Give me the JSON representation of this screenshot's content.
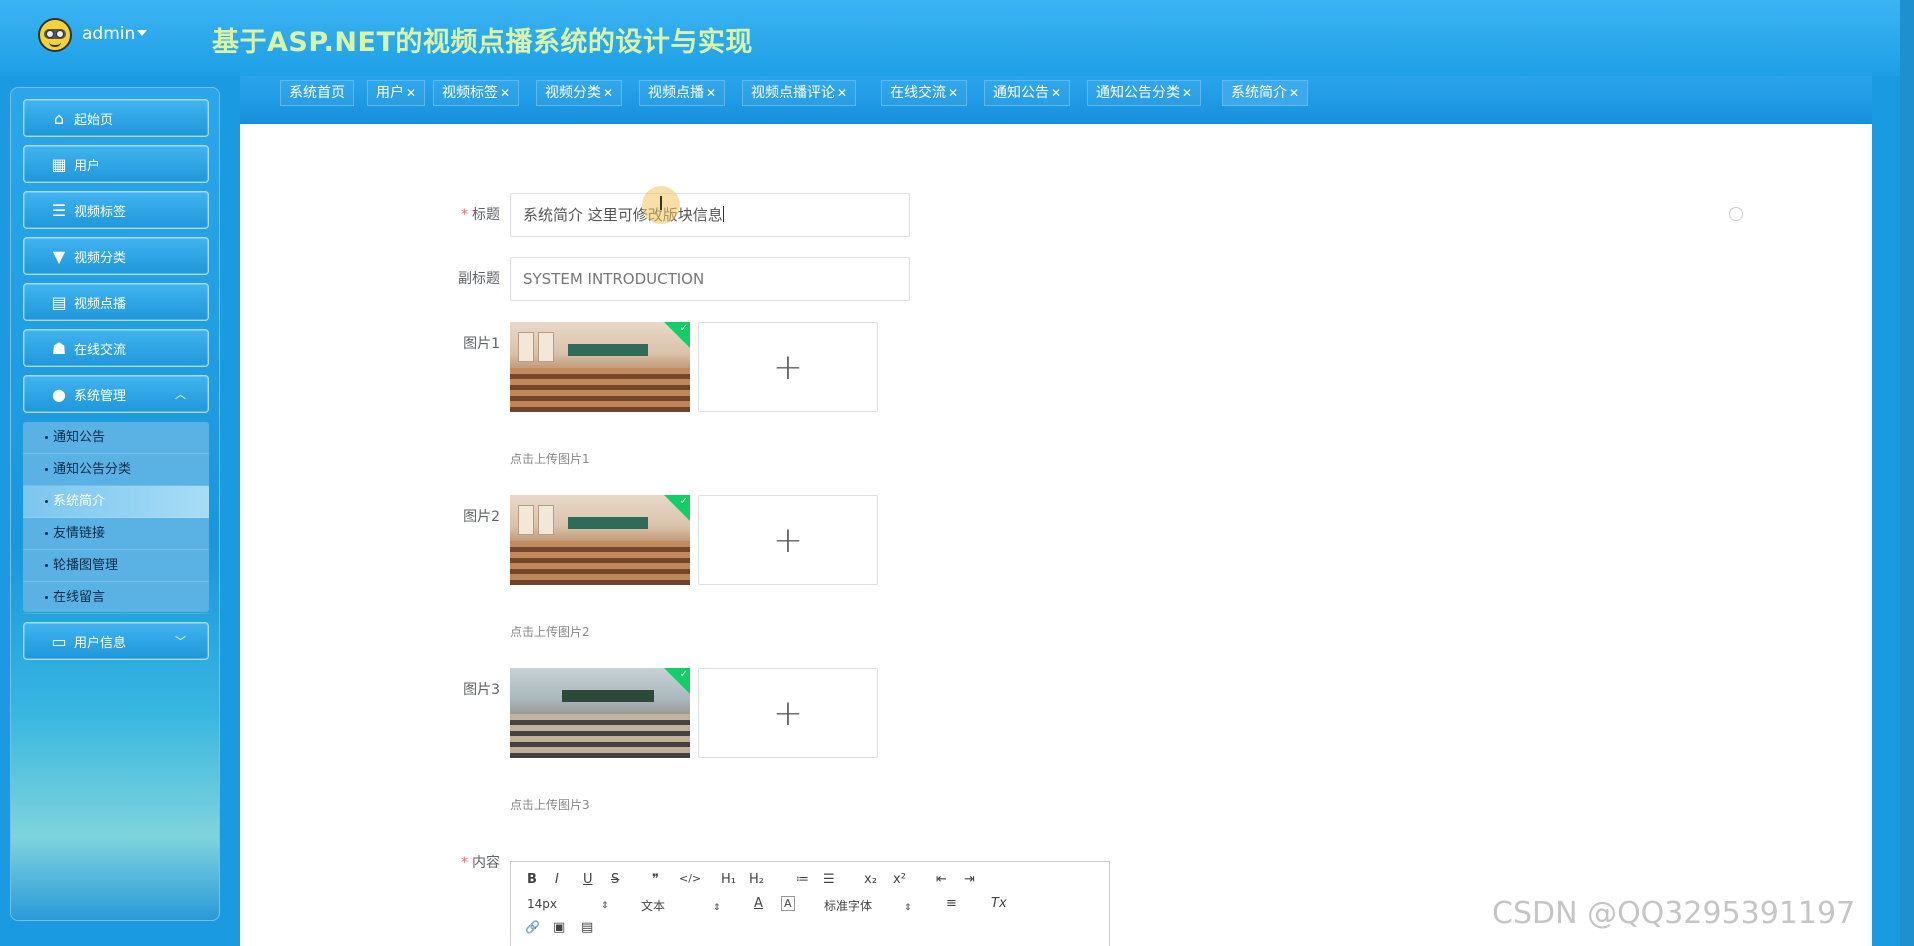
{
  "header": {
    "user": "admin",
    "title": "基于ASP.NET的视频点播系统的设计与实现"
  },
  "sidebar": {
    "items": [
      {
        "label": "起始页",
        "icon": "home-icon"
      },
      {
        "label": "用户",
        "icon": "grid-icon"
      },
      {
        "label": "视频标签",
        "icon": "sliders-icon"
      },
      {
        "label": "视频分类",
        "icon": "brush-icon"
      },
      {
        "label": "视频点播",
        "icon": "store-icon"
      },
      {
        "label": "在线交流",
        "icon": "person-icon"
      },
      {
        "label": "系统管理",
        "icon": "bulb-icon",
        "expanded": true
      },
      {
        "label": "用户信息",
        "icon": "wallet-icon",
        "expanded": false
      }
    ],
    "submenu": [
      {
        "label": "通知公告",
        "active": false
      },
      {
        "label": "通知公告分类",
        "active": false
      },
      {
        "label": "系统简介",
        "active": true
      },
      {
        "label": "友情链接",
        "active": false
      },
      {
        "label": "轮播图管理",
        "active": false
      },
      {
        "label": "在线留言",
        "active": false
      }
    ]
  },
  "tabs": [
    {
      "label": "系统首页",
      "closable": false
    },
    {
      "label": "用户",
      "closable": true
    },
    {
      "label": "视频标签",
      "closable": true
    },
    {
      "label": "视频分类",
      "closable": true
    },
    {
      "label": "视频点播",
      "closable": true
    },
    {
      "label": "视频点播评论",
      "closable": true
    },
    {
      "label": "在线交流",
      "closable": true
    },
    {
      "label": "通知公告",
      "closable": true
    },
    {
      "label": "通知公告分类",
      "closable": true
    },
    {
      "label": "系统简介",
      "closable": true,
      "active": true
    }
  ],
  "form": {
    "title_label": "标题",
    "title_value": "系统简介 这里可修改版块信息",
    "subtitle_label": "副标题",
    "subtitle_value": "SYSTEM INTRODUCTION",
    "pic1_label": "图片1",
    "pic1_hint": "点击上传图片1",
    "pic2_label": "图片2",
    "pic2_hint": "点击上传图片2",
    "pic3_label": "图片3",
    "pic3_hint": "点击上传图片3",
    "content_label": "内容",
    "upload_plus": "+"
  },
  "editor": {
    "bold": "B",
    "italic": "I",
    "underline": "U",
    "strike": "S",
    "quote": "❞",
    "code": "</>",
    "h1": "H₁",
    "h2": "H₂",
    "ol": "≔",
    "ul": "☰",
    "sub": "x₂",
    "sup": "x²",
    "outdent": "⇤",
    "indent": "⇥",
    "size": "14px",
    "block": "文本",
    "font": "标准字体",
    "color": "A",
    "bg": "A",
    "align": "≡",
    "clear": "Tx",
    "link": "🔗",
    "image": "▣",
    "video": "▤"
  },
  "watermark": "CSDN @QQ3295391197"
}
